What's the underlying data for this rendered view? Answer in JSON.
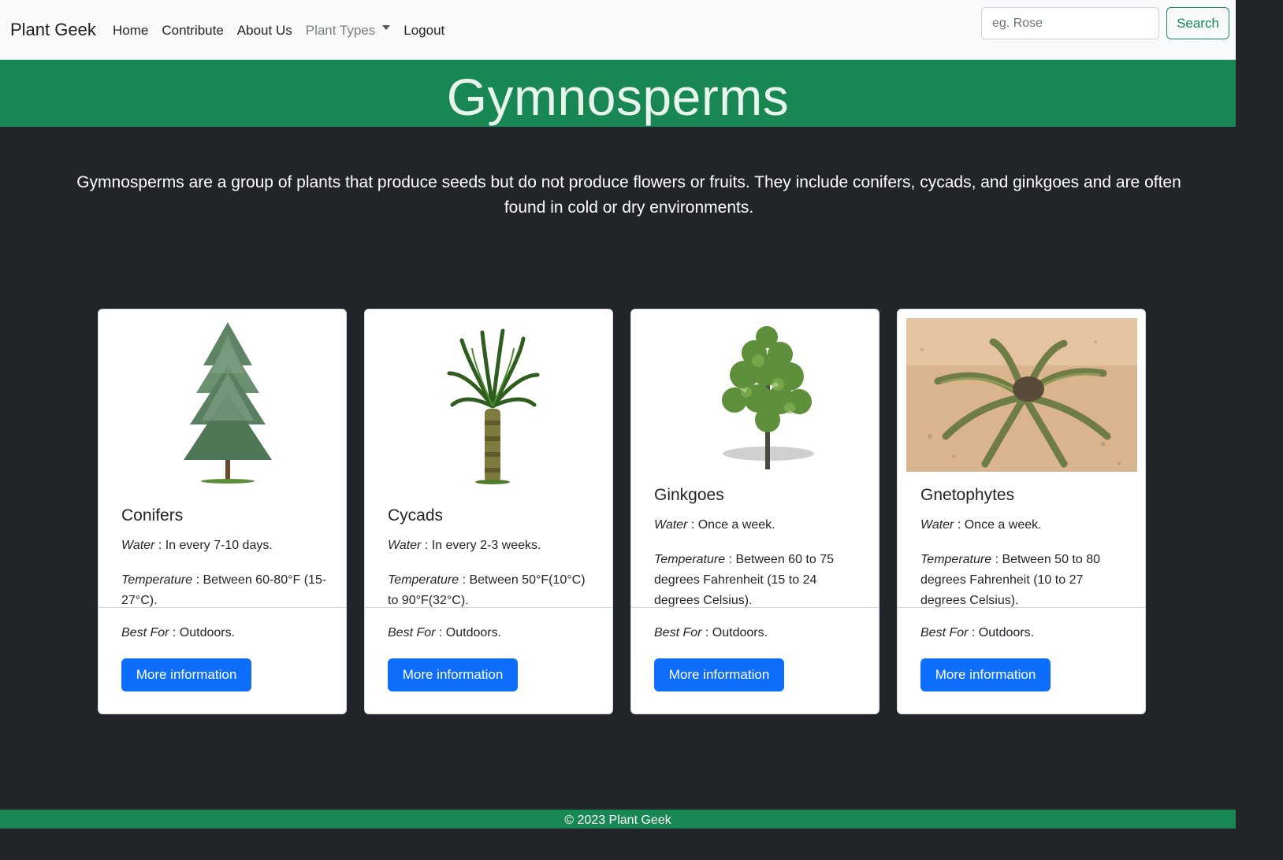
{
  "navbar": {
    "brand": "Plant Geek",
    "links": [
      "Home",
      "Contribute",
      "About Us",
      "Plant Types",
      "Logout"
    ],
    "search_placeholder": "eg. Rose",
    "search_button": "Search"
  },
  "hero": {
    "title": "Gymnosperms"
  },
  "intro": "Gymnosperms are a group of plants that produce seeds but do not produce flowers or fruits. They include conifers, cycads, and ginkgoes and are often found in cold or dry environments.",
  "labels": {
    "water": "Water",
    "temperature": "Temperature",
    "best_for": "Best For"
  },
  "cards": [
    {
      "title": "Conifers",
      "water": " : In every 7-10 days.",
      "temperature": " : Between 60-80°F (15-27°C).",
      "best_for": " : Outdoors.",
      "button": "More information",
      "image": "conifer-tree"
    },
    {
      "title": "Cycads",
      "water": " : In every 2-3 weeks.",
      "temperature": " : Between 50°F(10°C) to 90°F(32°C).",
      "best_for": " : Outdoors.",
      "button": "More information",
      "image": "cycad-palm"
    },
    {
      "title": "Ginkgoes",
      "water": " : Once a week.",
      "temperature": " : Between 60 to 75 degrees Fahrenheit (15 to 24 degrees Celsius).",
      "best_for": " : Outdoors.",
      "button": "More information",
      "image": "ginkgo-tree"
    },
    {
      "title": "Gnetophytes",
      "water": " : Once a week.",
      "temperature": " : Between 50 to 80 degrees Fahrenheit (10 to 27 degrees Celsius).",
      "best_for": " : Outdoors.",
      "button": "More information",
      "image": "welwitschia-photo"
    }
  ],
  "footer": "© 2023 Plant Geek",
  "colors": {
    "green": "#198754",
    "dark": "#212529",
    "primary": "#0d6efd",
    "navbar": "#f8f9fa"
  }
}
